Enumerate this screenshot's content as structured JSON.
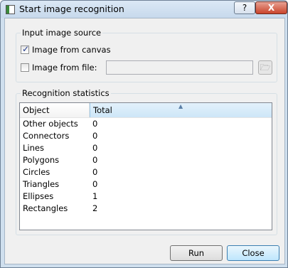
{
  "window": {
    "title": "Start image recognition",
    "help_label": "?",
    "close_label": "X"
  },
  "input_source": {
    "group_title": "Input image source",
    "from_canvas": {
      "label": "Image from canvas",
      "checked": true
    },
    "from_file": {
      "label": "Image from file:",
      "checked": false,
      "value": ""
    }
  },
  "stats": {
    "group_title": "Recognition statistics",
    "columns": [
      "Object",
      "Total"
    ],
    "rows": [
      {
        "object": "Other objects",
        "total": "0"
      },
      {
        "object": "Connectors",
        "total": "0"
      },
      {
        "object": "Lines",
        "total": "0"
      },
      {
        "object": "Polygons",
        "total": "0"
      },
      {
        "object": "Circles",
        "total": "0"
      },
      {
        "object": "Triangles",
        "total": "0"
      },
      {
        "object": "Ellipses",
        "total": "1"
      },
      {
        "object": "Rectangles",
        "total": "2"
      }
    ]
  },
  "buttons": {
    "run": "Run",
    "close": "Close"
  },
  "icons": {
    "app": "app-icon",
    "browse": "folder-open-icon",
    "sort": "sort-ascending-icon"
  }
}
